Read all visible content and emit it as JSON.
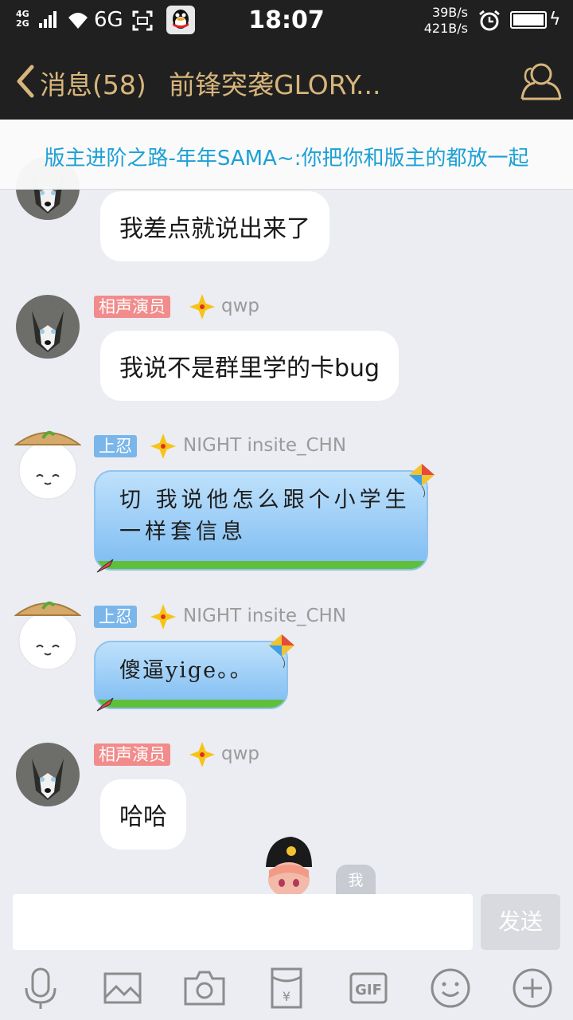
{
  "status_bar": {
    "signal_top": "4G",
    "signal_bottom": "2G",
    "network": "6G",
    "time": "18:07",
    "speed_up": "39B/s",
    "speed_down": "421B/s"
  },
  "nav": {
    "back_label": "消息(58)",
    "title": "前锋突袭GLORY..."
  },
  "notice": {
    "text": "版主进阶之路-年年SAMA~:你把你和版主的都放一起"
  },
  "messages": [
    {
      "text": "我差点就说出来了"
    },
    {
      "badge": "相声演员",
      "name": "qwp",
      "text": "我说不是群里学的卡bug"
    },
    {
      "badge": "上忍",
      "name": "NIGHT insite_CHN",
      "line1": "切 我说他怎么跟个小学生",
      "line2": "一样套信息"
    },
    {
      "badge": "上忍",
      "name": "NIGHT insite_CHN",
      "text": "傻逼yige。。"
    },
    {
      "badge": "相声演员",
      "name": "qwp",
      "text": "哈哈"
    }
  ],
  "me_tag": "我",
  "input": {
    "placeholder": "",
    "send_label": "发送"
  },
  "toolbar": {
    "gif_label": "GIF",
    "yuan_label": "¥"
  },
  "colors": {
    "bar_bg": "#202020",
    "nav_gold": "#d8b57c",
    "notice_blue": "#1ca0d6",
    "badge_pink": "#f28b8b",
    "badge_blue": "#7ab6ea",
    "chat_bg": "#ebedf2"
  }
}
